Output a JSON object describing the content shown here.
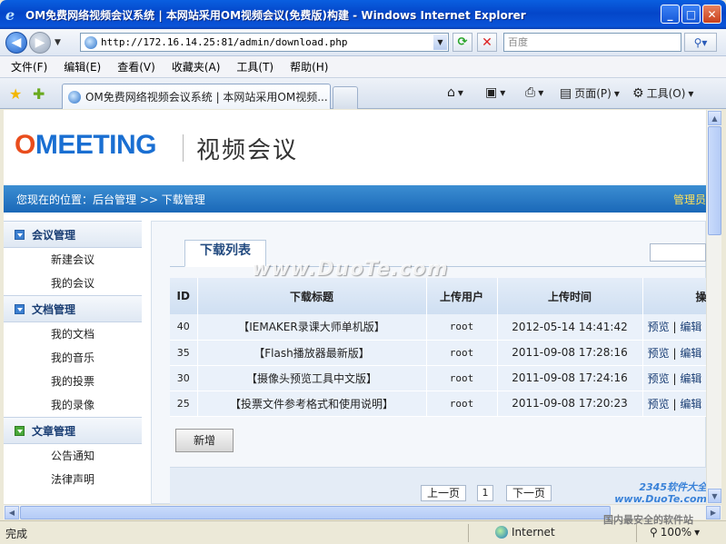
{
  "window": {
    "title": "OM免费网络视频会议系统 | 本网站采用OM视频会议(免费版)构建 - Windows Internet Explorer",
    "minimize": "_",
    "maximize": "□",
    "close": "✕"
  },
  "address": {
    "url": "http://172.16.14.25:81/admin/download.php",
    "search_placeholder": "百度"
  },
  "menu": [
    "文件(F)",
    "编辑(E)",
    "查看(V)",
    "收藏夹(A)",
    "工具(T)",
    "帮助(H)"
  ],
  "tab": {
    "label": "OM免费网络视频会议系统 | 本网站采用OM视频..."
  },
  "commands": {
    "page": "页面(P)",
    "tools": "工具(O)"
  },
  "page": {
    "logo": "OMEETING",
    "logo_cn": "视频会议",
    "breadcrumb": "您现在的位置：后台管理  >>  下载管理",
    "admin_label": "管理员"
  },
  "sidebar": [
    {
      "title": "会议管理",
      "items": [
        "新建会议",
        "我的会议"
      ]
    },
    {
      "title": "文档管理",
      "items": [
        "我的文档",
        "我的音乐",
        "我的投票",
        "我的录像"
      ]
    },
    {
      "title": "文章管理",
      "items": [
        "公告通知",
        "法律声明"
      ]
    }
  ],
  "main": {
    "tab_title": "下载列表",
    "watermark": "www.DuoTe.com",
    "columns": [
      "ID",
      "下载标题",
      "上传用户",
      "上传时间",
      "操"
    ],
    "rows": [
      {
        "id": "40",
        "title": "【IEMAKER录课大师单机版】",
        "user": "root",
        "time": "2012-05-14  14:41:42",
        "preview": "预览",
        "edit": "编辑"
      },
      {
        "id": "35",
        "title": "【Flash播放器最新版】",
        "user": "root",
        "time": "2011-09-08  17:28:16",
        "preview": "预览",
        "edit": "编辑"
      },
      {
        "id": "30",
        "title": "【摄像头预览工具中文版】",
        "user": "root",
        "time": "2011-09-08  17:24:16",
        "preview": "预览",
        "edit": "编辑"
      },
      {
        "id": "25",
        "title": "【投票文件参考格式和使用说明】",
        "user": "root",
        "time": "2011-09-08  17:20:23",
        "preview": "预览",
        "edit": "编辑"
      }
    ],
    "add_button": "新增",
    "pager": {
      "prev": "上一页",
      "current": "1",
      "next": "下一页"
    }
  },
  "watermark_badge": {
    "line1": "2345软件大全",
    "line2": "www.DuoTe.com",
    "line3": "国内最安全的软件站"
  },
  "status": {
    "text": "完成",
    "zone": "Internet",
    "zoom": "100%"
  }
}
